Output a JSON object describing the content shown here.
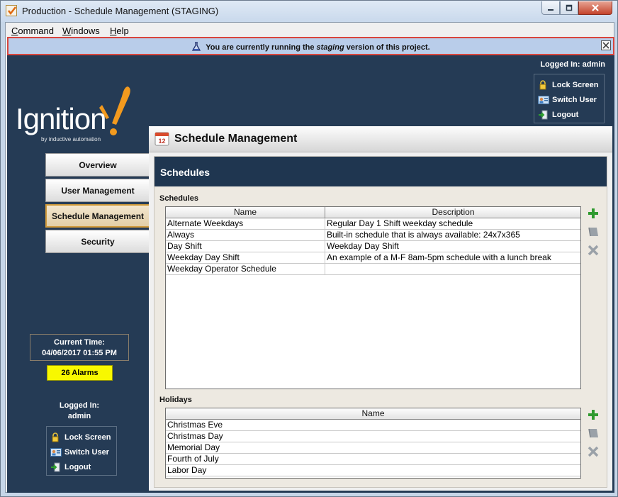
{
  "window": {
    "title": "Production - Schedule Management (STAGING)"
  },
  "menubar": {
    "items": [
      {
        "label": "Command"
      },
      {
        "label": "Windows"
      },
      {
        "label": "Help"
      }
    ]
  },
  "banner": {
    "text_before": "You are currently running the ",
    "text_emph": "staging",
    "text_after": " version of this project."
  },
  "logo": {
    "word": "Ignition",
    "tagline": "by inductive automation"
  },
  "top_right": {
    "logged_in": "Logged In: admin",
    "lock_label": "Lock Screen",
    "switch_label": "Switch User",
    "logout_label": "Logout"
  },
  "nav": {
    "items": [
      {
        "label": "Overview"
      },
      {
        "label": "User Management"
      },
      {
        "label": "Schedule Management"
      },
      {
        "label": "Security"
      }
    ],
    "active": "Schedule Management"
  },
  "status": {
    "time_label": "Current Time:",
    "time_value": "04/06/2017 01:55 PM",
    "alarms": "26 Alarms"
  },
  "bottom_left": {
    "logged_label": "Logged In:",
    "user": "admin",
    "lock_label": "Lock Screen",
    "switch_label": "Switch User",
    "logout_label": "Logout"
  },
  "main": {
    "title": "Schedule Management",
    "section_title": "Schedules",
    "schedules": {
      "label": "Schedules",
      "columns": [
        "Name",
        "Description"
      ],
      "rows": [
        {
          "name": "Alternate Weekdays",
          "description": "Regular Day 1 Shift weekday schedule"
        },
        {
          "name": "Always",
          "description": "Built-in schedule that is always available: 24x7x365"
        },
        {
          "name": "Day Shift",
          "description": "Weekday Day Shift"
        },
        {
          "name": "Weekday Day Shift",
          "description": "An example of a M-F 8am-5pm schedule with a lunch break"
        },
        {
          "name": "Weekday Operator Schedule",
          "description": ""
        }
      ]
    },
    "holidays": {
      "label": "Holidays",
      "columns": [
        "Name"
      ],
      "rows": [
        {
          "name": "Christmas Eve"
        },
        {
          "name": "Christmas Day"
        },
        {
          "name": "Memorial Day"
        },
        {
          "name": "Fourth of July"
        },
        {
          "name": "Labor Day"
        }
      ]
    }
  }
}
